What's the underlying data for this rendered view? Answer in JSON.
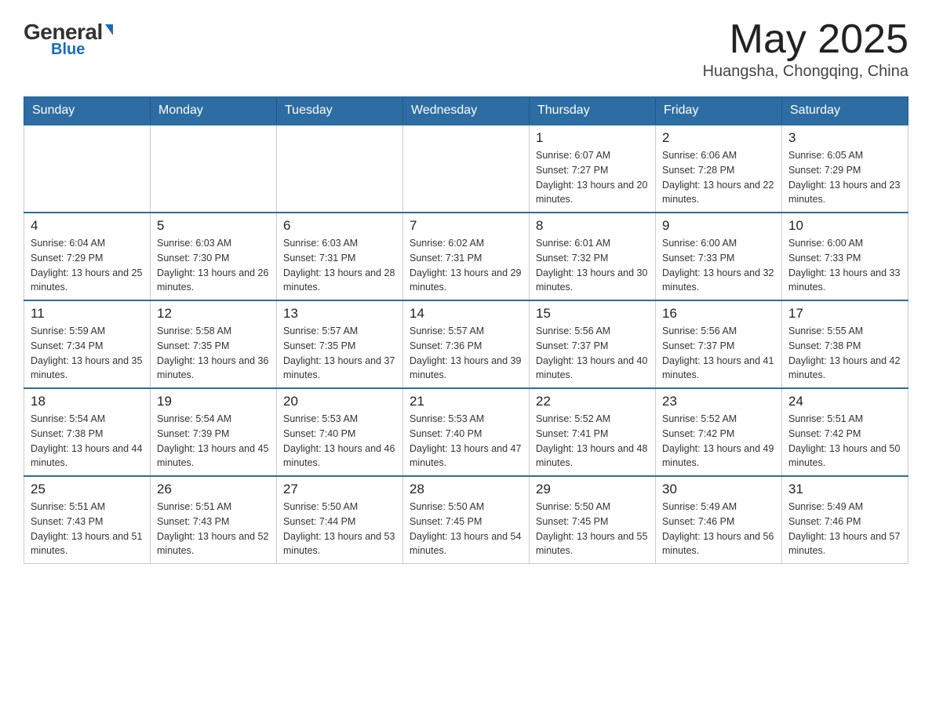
{
  "header": {
    "logo_general": "General",
    "logo_blue": "Blue",
    "title": "May 2025",
    "subtitle": "Huangsha, Chongqing, China"
  },
  "weekdays": [
    "Sunday",
    "Monday",
    "Tuesday",
    "Wednesday",
    "Thursday",
    "Friday",
    "Saturday"
  ],
  "weeks": [
    [
      {
        "day": "",
        "info": ""
      },
      {
        "day": "",
        "info": ""
      },
      {
        "day": "",
        "info": ""
      },
      {
        "day": "",
        "info": ""
      },
      {
        "day": "1",
        "info": "Sunrise: 6:07 AM\nSunset: 7:27 PM\nDaylight: 13 hours and 20 minutes."
      },
      {
        "day": "2",
        "info": "Sunrise: 6:06 AM\nSunset: 7:28 PM\nDaylight: 13 hours and 22 minutes."
      },
      {
        "day": "3",
        "info": "Sunrise: 6:05 AM\nSunset: 7:29 PM\nDaylight: 13 hours and 23 minutes."
      }
    ],
    [
      {
        "day": "4",
        "info": "Sunrise: 6:04 AM\nSunset: 7:29 PM\nDaylight: 13 hours and 25 minutes."
      },
      {
        "day": "5",
        "info": "Sunrise: 6:03 AM\nSunset: 7:30 PM\nDaylight: 13 hours and 26 minutes."
      },
      {
        "day": "6",
        "info": "Sunrise: 6:03 AM\nSunset: 7:31 PM\nDaylight: 13 hours and 28 minutes."
      },
      {
        "day": "7",
        "info": "Sunrise: 6:02 AM\nSunset: 7:31 PM\nDaylight: 13 hours and 29 minutes."
      },
      {
        "day": "8",
        "info": "Sunrise: 6:01 AM\nSunset: 7:32 PM\nDaylight: 13 hours and 30 minutes."
      },
      {
        "day": "9",
        "info": "Sunrise: 6:00 AM\nSunset: 7:33 PM\nDaylight: 13 hours and 32 minutes."
      },
      {
        "day": "10",
        "info": "Sunrise: 6:00 AM\nSunset: 7:33 PM\nDaylight: 13 hours and 33 minutes."
      }
    ],
    [
      {
        "day": "11",
        "info": "Sunrise: 5:59 AM\nSunset: 7:34 PM\nDaylight: 13 hours and 35 minutes."
      },
      {
        "day": "12",
        "info": "Sunrise: 5:58 AM\nSunset: 7:35 PM\nDaylight: 13 hours and 36 minutes."
      },
      {
        "day": "13",
        "info": "Sunrise: 5:57 AM\nSunset: 7:35 PM\nDaylight: 13 hours and 37 minutes."
      },
      {
        "day": "14",
        "info": "Sunrise: 5:57 AM\nSunset: 7:36 PM\nDaylight: 13 hours and 39 minutes."
      },
      {
        "day": "15",
        "info": "Sunrise: 5:56 AM\nSunset: 7:37 PM\nDaylight: 13 hours and 40 minutes."
      },
      {
        "day": "16",
        "info": "Sunrise: 5:56 AM\nSunset: 7:37 PM\nDaylight: 13 hours and 41 minutes."
      },
      {
        "day": "17",
        "info": "Sunrise: 5:55 AM\nSunset: 7:38 PM\nDaylight: 13 hours and 42 minutes."
      }
    ],
    [
      {
        "day": "18",
        "info": "Sunrise: 5:54 AM\nSunset: 7:38 PM\nDaylight: 13 hours and 44 minutes."
      },
      {
        "day": "19",
        "info": "Sunrise: 5:54 AM\nSunset: 7:39 PM\nDaylight: 13 hours and 45 minutes."
      },
      {
        "day": "20",
        "info": "Sunrise: 5:53 AM\nSunset: 7:40 PM\nDaylight: 13 hours and 46 minutes."
      },
      {
        "day": "21",
        "info": "Sunrise: 5:53 AM\nSunset: 7:40 PM\nDaylight: 13 hours and 47 minutes."
      },
      {
        "day": "22",
        "info": "Sunrise: 5:52 AM\nSunset: 7:41 PM\nDaylight: 13 hours and 48 minutes."
      },
      {
        "day": "23",
        "info": "Sunrise: 5:52 AM\nSunset: 7:42 PM\nDaylight: 13 hours and 49 minutes."
      },
      {
        "day": "24",
        "info": "Sunrise: 5:51 AM\nSunset: 7:42 PM\nDaylight: 13 hours and 50 minutes."
      }
    ],
    [
      {
        "day": "25",
        "info": "Sunrise: 5:51 AM\nSunset: 7:43 PM\nDaylight: 13 hours and 51 minutes."
      },
      {
        "day": "26",
        "info": "Sunrise: 5:51 AM\nSunset: 7:43 PM\nDaylight: 13 hours and 52 minutes."
      },
      {
        "day": "27",
        "info": "Sunrise: 5:50 AM\nSunset: 7:44 PM\nDaylight: 13 hours and 53 minutes."
      },
      {
        "day": "28",
        "info": "Sunrise: 5:50 AM\nSunset: 7:45 PM\nDaylight: 13 hours and 54 minutes."
      },
      {
        "day": "29",
        "info": "Sunrise: 5:50 AM\nSunset: 7:45 PM\nDaylight: 13 hours and 55 minutes."
      },
      {
        "day": "30",
        "info": "Sunrise: 5:49 AM\nSunset: 7:46 PM\nDaylight: 13 hours and 56 minutes."
      },
      {
        "day": "31",
        "info": "Sunrise: 5:49 AM\nSunset: 7:46 PM\nDaylight: 13 hours and 57 minutes."
      }
    ]
  ]
}
